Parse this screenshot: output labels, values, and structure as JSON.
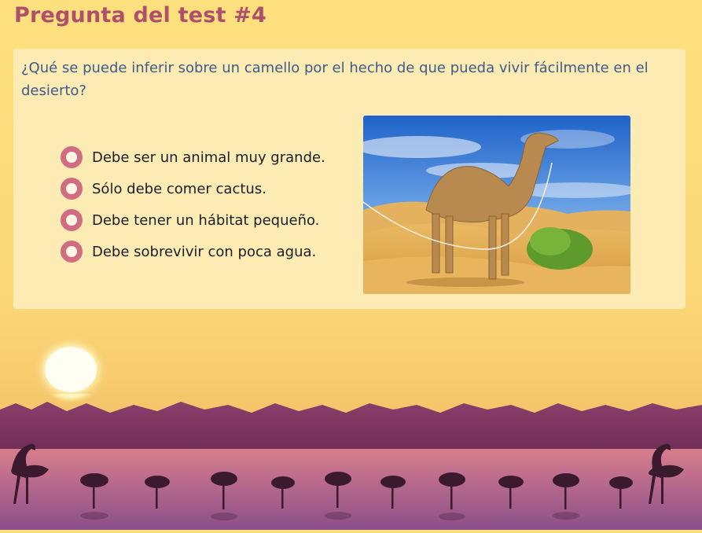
{
  "page": {
    "title": "Pregunta del test #4"
  },
  "question": {
    "text": "¿Qué se puede inferir sobre un camello por el hecho de que pueda vivir fácilmente en el desierto?"
  },
  "options": [
    {
      "label": "Debe ser un animal muy grande."
    },
    {
      "label": "Sólo debe comer cactus."
    },
    {
      "label": "Debe tener un hábitat pequeño."
    },
    {
      "label": "Debe sobrevivir con poca agua."
    }
  ],
  "colors": {
    "title": "#b04f6b",
    "question": "#3f5a8c",
    "radio_ring": "#d16d80",
    "card": "#fcebb2",
    "background": "#fde07e"
  },
  "icons": {
    "radio": "radio-button-icon",
    "photo": "camel-in-desert-image",
    "scenery": "sunset-flamingo-lake-illustration"
  }
}
